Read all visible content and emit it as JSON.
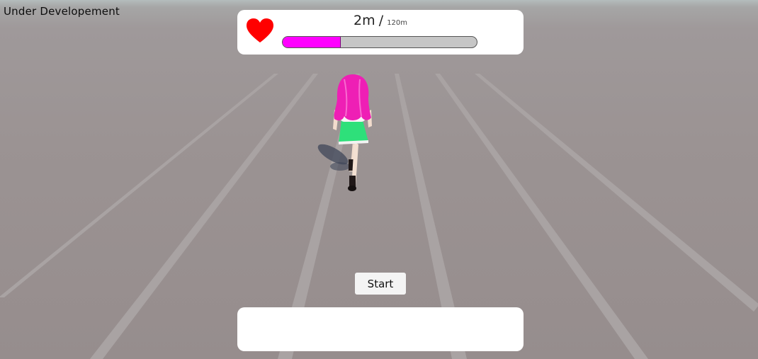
{
  "hud": {
    "dev_label": "Under Developement",
    "distance_current": "2m",
    "distance_separator": "/",
    "distance_total": "120m",
    "progress_fraction": 0.3,
    "progress_color": "#ff00ff",
    "heart_color": "#ff0000",
    "heart_icon": "heart-icon"
  },
  "controls": {
    "start_label": "Start"
  },
  "bottom_panel": {
    "text": ""
  }
}
